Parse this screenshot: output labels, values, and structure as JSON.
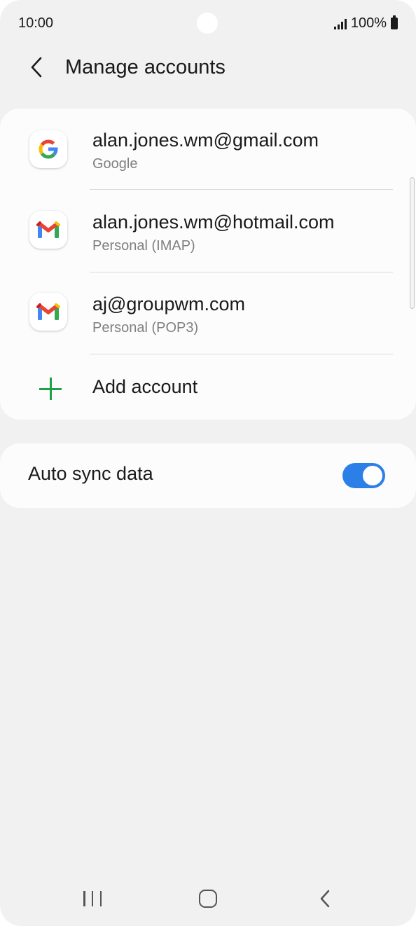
{
  "status_bar": {
    "time": "10:00",
    "battery_percent": "100%"
  },
  "header": {
    "title": "Manage accounts"
  },
  "accounts": [
    {
      "email": "alan.jones.wm@gmail.com",
      "type": "Google",
      "icon": "google-icon"
    },
    {
      "email": "alan.jones.wm@hotmail.com",
      "type": "Personal (IMAP)",
      "icon": "gmail-icon"
    },
    {
      "email": "aj@groupwm.com",
      "type": "Personal (POP3)",
      "icon": "gmail-icon"
    }
  ],
  "add_account": {
    "label": "Add account",
    "icon": "plus-icon",
    "color": "#1fa14a"
  },
  "auto_sync": {
    "label": "Auto sync data",
    "enabled": true,
    "accent": "#2d7fe8"
  },
  "nav_bar": {
    "icons": [
      "recents-icon",
      "home-icon",
      "back-icon"
    ]
  }
}
